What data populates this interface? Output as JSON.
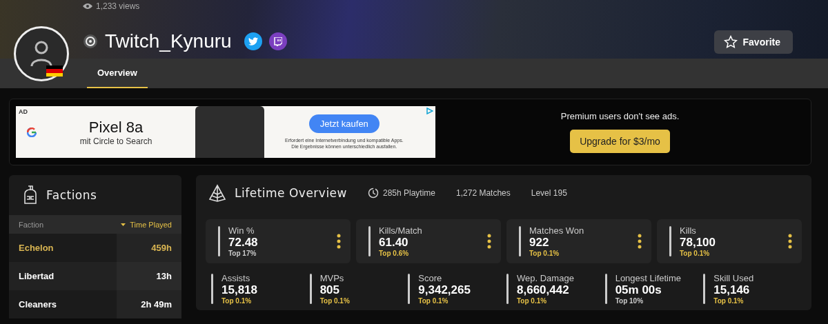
{
  "profile": {
    "views": "1,233 views",
    "name": "Twitch_Kynuru",
    "favorite": "Favorite"
  },
  "tabs": [
    {
      "label": "Overview",
      "selected": true
    }
  ],
  "ad": {
    "badge": "AD",
    "headline": "Pixel 8a",
    "subline": "mit Circle to Search",
    "cta": "Jetzt kaufen",
    "disclaimer": [
      "Erfordert eine Internetverbindung und kompatible Apps.",
      "Die Ergebnisse können unterschiedlich ausfallen."
    ],
    "premium_note": "Premium users don't see ads.",
    "upgrade": "Upgrade for $3/mo"
  },
  "factions": {
    "title": "Factions",
    "columns": [
      "Faction",
      "Time Played"
    ],
    "rows": [
      {
        "name": "Echelon",
        "time": "459h",
        "selected": true
      },
      {
        "name": "Libertad",
        "time": "13h",
        "selected": false
      },
      {
        "name": "Cleaners",
        "time": "2h 49m",
        "selected": false
      }
    ]
  },
  "overview": {
    "title": "Lifetime Overview",
    "playtime": "285h Playtime",
    "matches": "1,272 Matches",
    "level": "Level 195",
    "main_stats": [
      {
        "label": "Win %",
        "value": "72.48",
        "rank": "Top 17%",
        "color": "#cccccc"
      },
      {
        "label": "Kills/Match",
        "value": "61.40",
        "rank": "Top 0.6%",
        "color": "#e6c146"
      },
      {
        "label": "Matches Won",
        "value": "922",
        "rank": "Top 0.1%",
        "color": "#e6c146"
      },
      {
        "label": "Kills",
        "value": "78,100",
        "rank": "Top 0.1%",
        "color": "#e6c146"
      }
    ],
    "stats": [
      {
        "label": "Assists",
        "value": "15,818",
        "rank": "Top 0.1%",
        "color": "#e6c146"
      },
      {
        "label": "MVPs",
        "value": "805",
        "rank": "Top 0.1%",
        "color": "#e6c146"
      },
      {
        "label": "Score",
        "value": "9,342,265",
        "rank": "Top 0.1%",
        "color": "#e6c146"
      },
      {
        "label": "Wep. Damage",
        "value": "8,660,442",
        "rank": "Top 0.1%",
        "color": "#e6c146"
      },
      {
        "label": "Longest Lifetime",
        "value": "05m 00s",
        "rank": "Top 10%",
        "color": "#cccccc"
      },
      {
        "label": "Skill Used",
        "value": "15,146",
        "rank": "Top 0.1%",
        "color": "#e6c146"
      }
    ]
  }
}
